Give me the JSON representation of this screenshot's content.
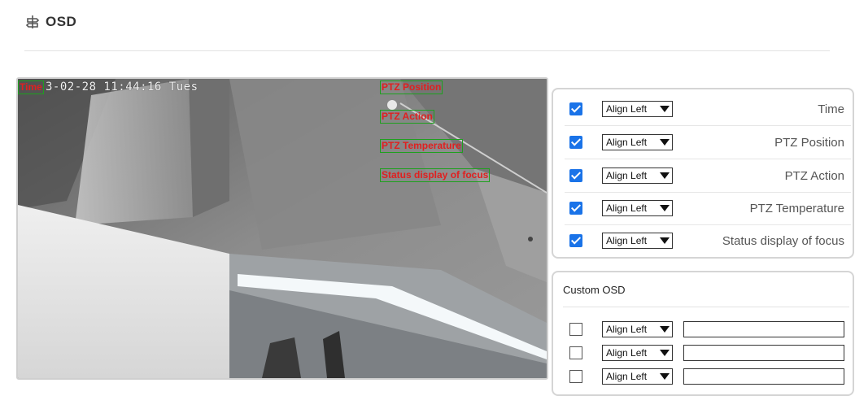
{
  "header": {
    "title": "OSD",
    "icon": "osd-settings-icon"
  },
  "video": {
    "time_overlay": "3-02-28 11:44:16 Tues",
    "tags": [
      {
        "key": "time",
        "label": "Time"
      },
      {
        "key": "ptz_position",
        "label": "PTZ Position"
      },
      {
        "key": "ptz_action",
        "label": "PTZ Action"
      },
      {
        "key": "ptz_temperature",
        "label": "PTZ Temperature"
      },
      {
        "key": "focus",
        "label": "Status display of focus"
      }
    ]
  },
  "osd_items": [
    {
      "checked": true,
      "align": "Align Left",
      "label": "Time"
    },
    {
      "checked": true,
      "align": "Align Left",
      "label": "PTZ Position"
    },
    {
      "checked": true,
      "align": "Align Left",
      "label": "PTZ Action"
    },
    {
      "checked": true,
      "align": "Align Left",
      "label": "PTZ Temperature"
    },
    {
      "checked": true,
      "align": "Align Left",
      "label": "Status display of focus"
    }
  ],
  "custom_osd": {
    "title": "Custom OSD",
    "rows": [
      {
        "checked": false,
        "align": "Align Left",
        "value": ""
      },
      {
        "checked": false,
        "align": "Align Left",
        "value": ""
      },
      {
        "checked": false,
        "align": "Align Left",
        "value": ""
      }
    ]
  },
  "colors": {
    "accent": "#1a73e8",
    "osd_text": "#e02020",
    "osd_box": "#1ea01e"
  }
}
